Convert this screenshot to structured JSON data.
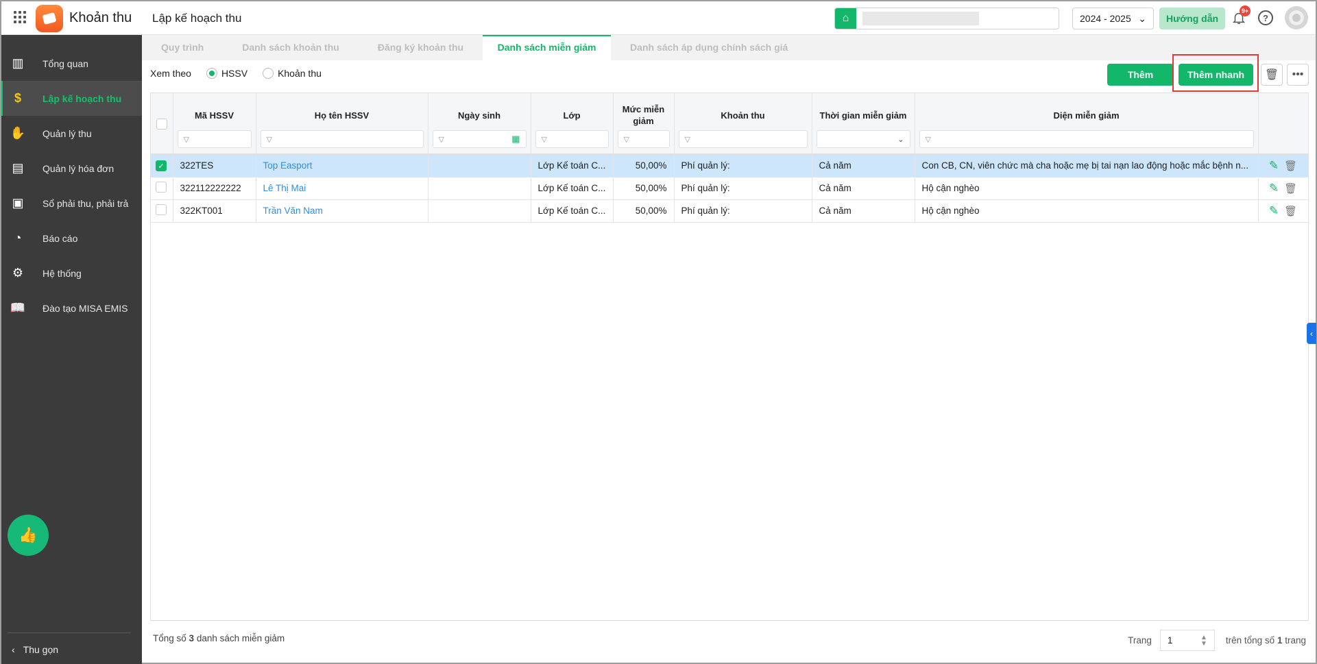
{
  "header": {
    "app_name": "Khoản thu",
    "page_title": "Lập kế hoạch thu",
    "school_year": "2024 - 2025",
    "guide_label": "Hướng dẫn",
    "notification_badge": "9+"
  },
  "sidebar": {
    "items": [
      {
        "label": "Tổng quan",
        "icon": "bar-chart-icon"
      },
      {
        "label": "Lập kế hoạch thu",
        "icon": "calendar-dollar-icon",
        "active": true
      },
      {
        "label": "Quản lý thu",
        "icon": "hand-coin-icon"
      },
      {
        "label": "Quản lý hóa đơn",
        "icon": "invoice-icon"
      },
      {
        "label": "Sổ phải thu, phải trả",
        "icon": "ledger-icon"
      },
      {
        "label": "Báo cáo",
        "icon": "pie-chart-icon"
      },
      {
        "label": "Hệ thống",
        "icon": "gear-icon"
      },
      {
        "label": "Đào tạo MISA EMIS",
        "icon": "book-icon"
      }
    ],
    "collapse_label": "Thu gọn"
  },
  "tabs": [
    {
      "label": "Quy trình"
    },
    {
      "label": "Danh sách khoản thu"
    },
    {
      "label": "Đăng ký khoản thu"
    },
    {
      "label": "Danh sách miễn giảm",
      "active": true
    },
    {
      "label": "Danh sách áp dụng chính sách giá"
    }
  ],
  "view_by": {
    "label": "Xem theo",
    "options": [
      "HSSV",
      "Khoản thu"
    ],
    "selected": "HSSV"
  },
  "toolbar": {
    "add_label": "Thêm",
    "quick_add_label": "Thêm nhanh"
  },
  "table": {
    "columns": [
      "Mã HSSV",
      "Họ tên HSSV",
      "Ngày sinh",
      "Lớp",
      "Mức miễn giảm",
      "Khoản thu",
      "Thời gian miễn giảm",
      "Diện miễn giảm"
    ],
    "rows": [
      {
        "checked": true,
        "code": "322TES",
        "name": "Top Easport",
        "dob": "",
        "class": "Lớp Kế toán C...",
        "rate": "50,00%",
        "fee": "Phí quản lý:",
        "period": "Cả năm",
        "category": "Con CB, CN, viên chức mà cha hoặc mẹ bị tai nạn lao động hoặc mắc bệnh n..."
      },
      {
        "checked": false,
        "code": "322112222222",
        "name": "Lê Thị Mai",
        "dob": "",
        "class": "Lớp Kế toán C...",
        "rate": "50,00%",
        "fee": "Phí quản lý:",
        "period": "Cả năm",
        "category": "Hộ cận nghèo"
      },
      {
        "checked": false,
        "code": "322KT001",
        "name": "Trần Văn Nam",
        "dob": "",
        "class": "Lớp Kế toán C...",
        "rate": "50,00%",
        "fee": "Phí quản lý:",
        "period": "Cả năm",
        "category": "Hộ cận nghèo"
      }
    ]
  },
  "footer": {
    "total_prefix": "Tổng số",
    "total_count": "3",
    "total_suffix": "danh sách miễn giảm",
    "page_label": "Trang",
    "page_value": "1",
    "pages_prefix": "trên tổng số",
    "pages_count": "1",
    "pages_suffix": "trang"
  },
  "colors": {
    "primary": "#12b76a",
    "selected_row": "#cde6fb",
    "sidebar": "#3b3b3b",
    "highlight_box": "#e53935"
  }
}
